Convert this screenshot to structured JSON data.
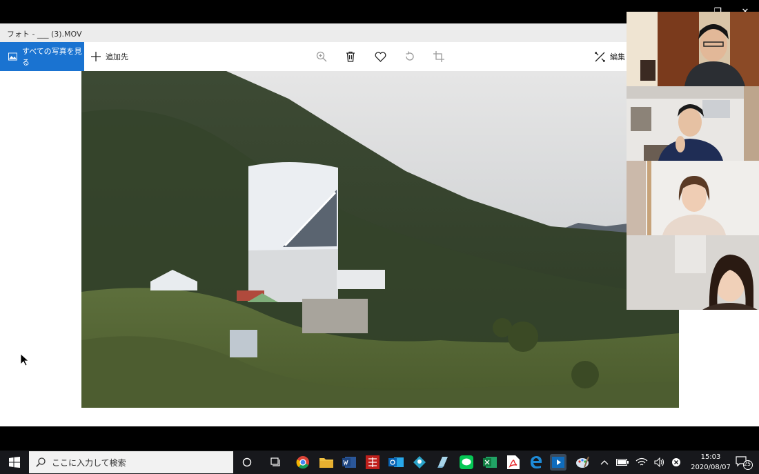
{
  "window": {
    "title": "フォト - ___ (3).MOV"
  },
  "toolbar": {
    "all_photos_label": "すべての写真を見る",
    "add_to_label": "追加先",
    "edit_label": "編集と",
    "icons": [
      "zoom-icon",
      "trash-icon",
      "heart-icon",
      "rotate-icon",
      "crop-icon"
    ]
  },
  "taskbar": {
    "search_placeholder": "ここに入力して検索",
    "time": "15:03",
    "date": "2020/08/07",
    "notification_count": "25",
    "app_icons": [
      "chrome",
      "file-explorer",
      "word",
      "ichitaro",
      "outlook",
      "maps",
      "app",
      "line",
      "excel",
      "acrobat",
      "edge",
      "photos",
      "paint"
    ]
  },
  "call": {
    "participants": 4
  },
  "colors": {
    "accent": "#1a73d1",
    "taskbar": "#17181c"
  }
}
